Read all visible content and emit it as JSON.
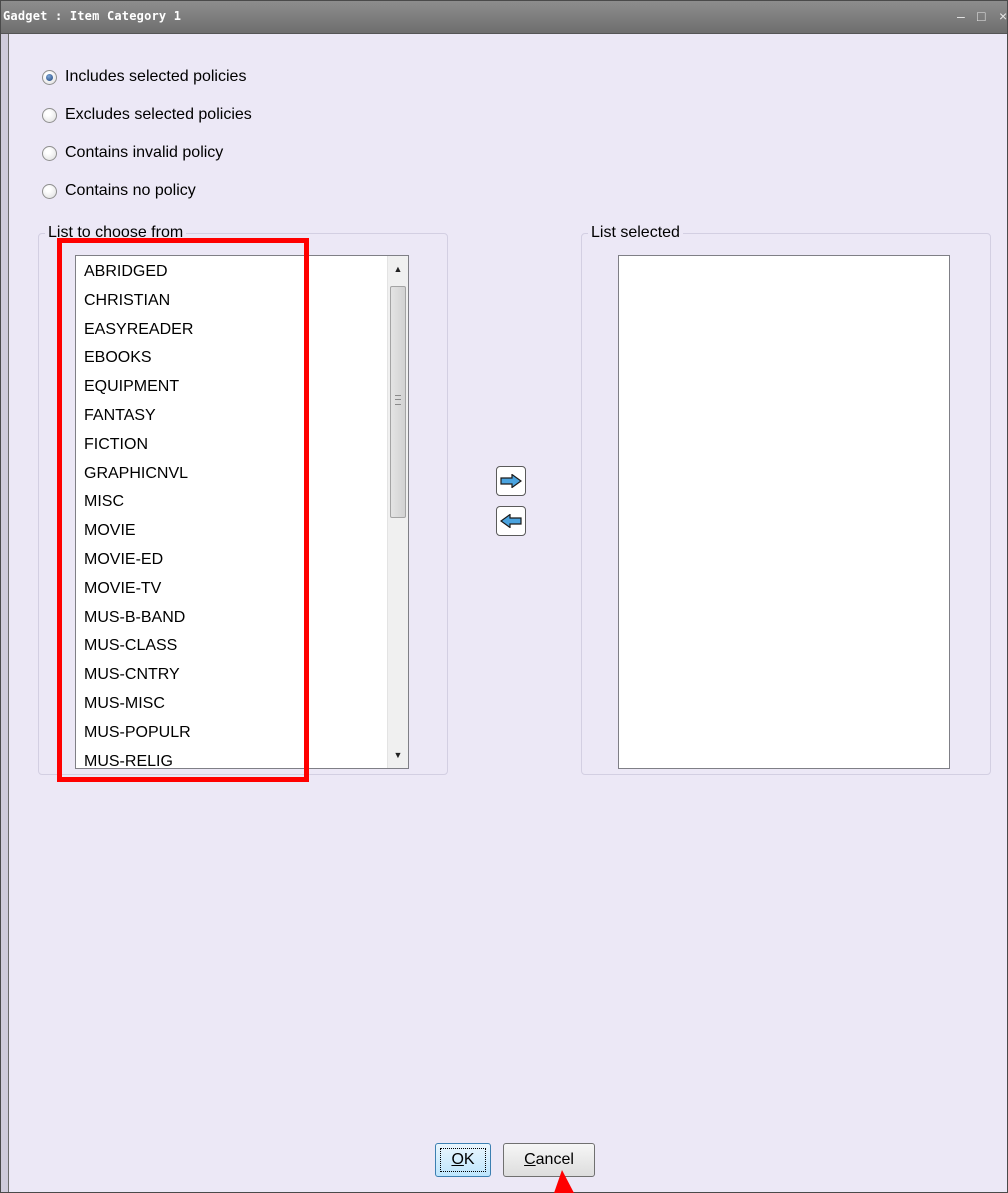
{
  "window": {
    "title": "Gadget : Item Category 1",
    "controls": [
      "–",
      "□",
      "×"
    ]
  },
  "options": [
    {
      "label": "Includes selected policies",
      "selected": true
    },
    {
      "label": "Excludes selected policies",
      "selected": false
    },
    {
      "label": "Contains invalid policy",
      "selected": false
    },
    {
      "label": "Contains no policy",
      "selected": false
    }
  ],
  "left_list": {
    "legend": "List to choose from",
    "items": [
      "ABRIDGED",
      "CHRISTIAN",
      "EASYREADER",
      "EBOOKS",
      "EQUIPMENT",
      "FANTASY",
      "FICTION",
      "GRAPHICNVL",
      "MISC",
      "MOVIE",
      "MOVIE-ED",
      "MOVIE-TV",
      "MUS-B-BAND",
      "MUS-CLASS",
      "MUS-CNTRY",
      "MUS-MISC",
      "MUS-POPULR",
      "MUS-RELIG"
    ]
  },
  "right_list": {
    "legend": "List selected",
    "items": []
  },
  "buttons": {
    "ok": {
      "mnemonic": "O",
      "rest": "K"
    },
    "cancel": {
      "mnemonic": "C",
      "rest": "ancel"
    }
  },
  "icons": {
    "add": "right-arrow-icon",
    "remove": "left-arrow-icon",
    "arrow_color": "#4aa3df"
  },
  "annotation_color": "#ff0000"
}
